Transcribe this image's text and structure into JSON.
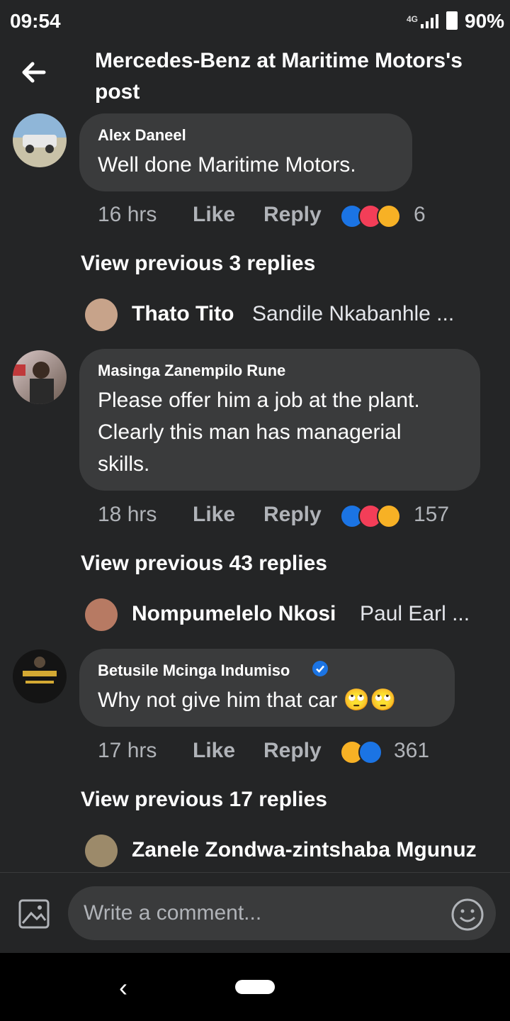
{
  "status": {
    "time": "09:54",
    "network": "4G",
    "battery": "90%"
  },
  "header": {
    "title": "Mercedes-Benz at Maritime Motors's post"
  },
  "comments": [
    {
      "author": "Alex Daneel",
      "text": "Well done Maritime Motors.",
      "time": "16 hrs",
      "like_label": "Like",
      "reply_label": "Reply",
      "reaction_count": "6",
      "view_replies": "View previous 3 replies",
      "reply_author": "Thato Tito",
      "reply_text": "Sandile Nkabanhle ..."
    },
    {
      "author": "Masinga Zanempilo Rune",
      "text_lines": [
        "Please offer him a job at the plant.",
        "Clearly this man has managerial",
        "skills."
      ],
      "time": "18 hrs",
      "like_label": "Like",
      "reply_label": "Reply",
      "reaction_count": "157",
      "view_replies": "View previous 43 replies",
      "reply_author": "Nompumelelo Nkosi",
      "reply_text": "Paul Earl ..."
    },
    {
      "author": "Betusile Mcinga Indumiso",
      "text": "Why not give him that car 🙄🙄",
      "time": "17 hrs",
      "like_label": "Like",
      "reply_label": "Reply",
      "reaction_count": "361",
      "view_replies": "View previous 17 replies",
      "reply_author": "Zanele Zondwa-zintshaba Mgunuz"
    }
  ],
  "composer": {
    "placeholder": "Write a comment..."
  },
  "colors": {
    "background": "#242526",
    "bubble": "#3a3b3c",
    "like": "#1b74e4",
    "love": "#f33e58",
    "verified": "#1b74e4"
  },
  "icons": [
    "back-arrow-icon",
    "photo-icon",
    "emoji-icon",
    "verified-badge-icon",
    "like-reaction-icon",
    "love-reaction-icon",
    "haha-reaction-icon",
    "nav-back-icon",
    "nav-home-icon"
  ]
}
